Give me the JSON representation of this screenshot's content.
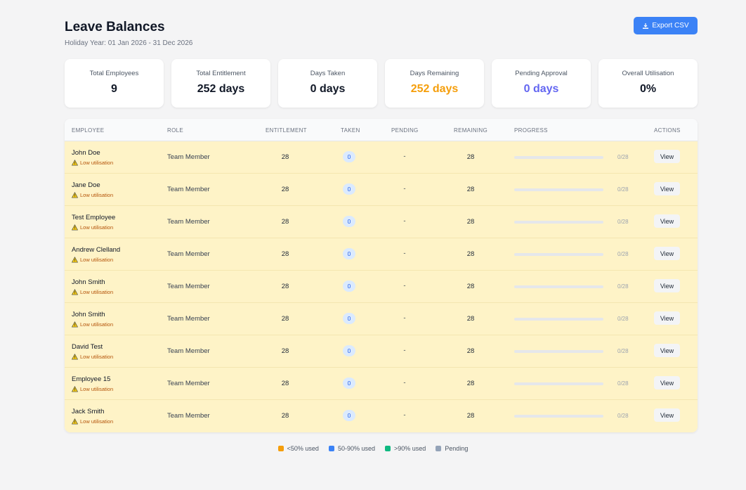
{
  "header": {
    "title": "Leave Balances",
    "subtitle": "Holiday Year: 01 Jan 2026 - 31 Dec 2026",
    "export_label": "Export CSV"
  },
  "stats": [
    {
      "label": "Total Employees",
      "value": "9"
    },
    {
      "label": "Total Entitlement",
      "value": "252 days"
    },
    {
      "label": "Days Taken",
      "value": "0 days"
    },
    {
      "label": "Days Remaining",
      "value": "252 days"
    },
    {
      "label": "Pending Approval",
      "value": "0 days"
    },
    {
      "label": "Overall Utilisation",
      "value": "0%"
    }
  ],
  "table": {
    "headers": {
      "employee": "EMPLOYEE",
      "role": "ROLE",
      "entitlement": "ENTITLEMENT",
      "taken": "TAKEN",
      "pending": "PENDING",
      "remaining": "REMAINING",
      "progress": "PROGRESS",
      "actions": "ACTIONS"
    },
    "warning_label": "Low utilisation",
    "view_label": "View",
    "rows": [
      {
        "name": "John Doe",
        "role": "Team Member",
        "entitlement": "28",
        "taken": "0",
        "pending": "-",
        "remaining": "28",
        "progress": "0/28",
        "used_fraction": 0
      },
      {
        "name": "Jane Doe",
        "role": "Team Member",
        "entitlement": "28",
        "taken": "0",
        "pending": "-",
        "remaining": "28",
        "progress": "0/28",
        "used_fraction": 0
      },
      {
        "name": "Test Employee",
        "role": "Team Member",
        "entitlement": "28",
        "taken": "0",
        "pending": "-",
        "remaining": "28",
        "progress": "0/28",
        "used_fraction": 0
      },
      {
        "name": "Andrew Clelland",
        "role": "Team Member",
        "entitlement": "28",
        "taken": "0",
        "pending": "-",
        "remaining": "28",
        "progress": "0/28",
        "used_fraction": 0
      },
      {
        "name": "John Smith",
        "role": "Team Member",
        "entitlement": "28",
        "taken": "0",
        "pending": "-",
        "remaining": "28",
        "progress": "0/28",
        "used_fraction": 0
      },
      {
        "name": "John Smith",
        "role": "Team Member",
        "entitlement": "28",
        "taken": "0",
        "pending": "-",
        "remaining": "28",
        "progress": "0/28",
        "used_fraction": 0
      },
      {
        "name": "David Test",
        "role": "Team Member",
        "entitlement": "28",
        "taken": "0",
        "pending": "-",
        "remaining": "28",
        "progress": "0/28",
        "used_fraction": 0
      },
      {
        "name": "Employee 15",
        "role": "Team Member",
        "entitlement": "28",
        "taken": "0",
        "pending": "-",
        "remaining": "28",
        "progress": "0/28",
        "used_fraction": 0
      },
      {
        "name": "Jack Smith",
        "role": "Team Member",
        "entitlement": "28",
        "taken": "0",
        "pending": "-",
        "remaining": "28",
        "progress": "0/28",
        "used_fraction": 0
      }
    ]
  },
  "legend": [
    {
      "label": "<50% used",
      "color": "#f59e0b"
    },
    {
      "label": "50-90% used",
      "color": "#3b82f6"
    },
    {
      "label": ">90% used",
      "color": "#10b981"
    },
    {
      "label": "Pending",
      "color": "#94a3b8"
    }
  ]
}
